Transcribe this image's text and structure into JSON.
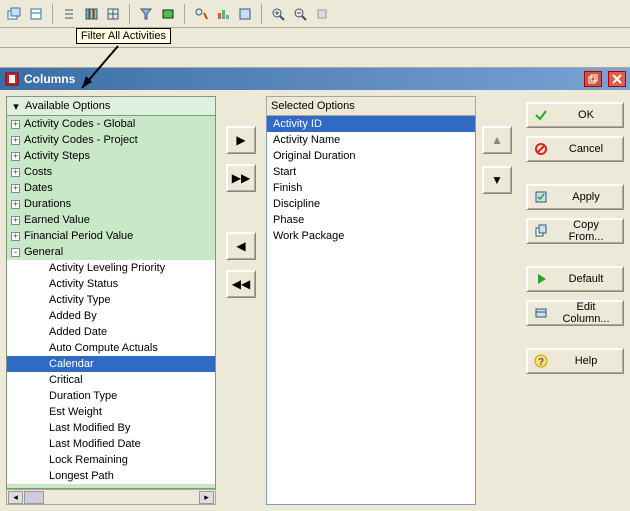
{
  "tooltip": "Filter All Activities",
  "dialog_title": "Columns",
  "available_header": "Available Options",
  "selected_header": "Selected Options",
  "tree_top": [
    "Activity Codes - Global",
    "Activity Codes - Project",
    "Activity Steps",
    "Costs",
    "Dates",
    "Durations",
    "Earned Value",
    "Financial Period Value"
  ],
  "tree_general_label": "General",
  "general_items": [
    "Activity Leveling Priority",
    "Activity Status",
    "Activity Type",
    "Added By",
    "Added Date",
    "Auto Compute Actuals",
    "Calendar",
    "Critical",
    "Duration Type",
    "Est Weight",
    "Last Modified By",
    "Last Modified Date",
    "Lock Remaining",
    "Longest Path"
  ],
  "general_selected_index": 6,
  "selected_items": [
    "Activity ID",
    "Activity Name",
    "Original Duration",
    "Start",
    "Finish",
    "Discipline",
    "Phase",
    "Work Package"
  ],
  "selected_active_index": 0,
  "buttons": {
    "ok": "OK",
    "cancel": "Cancel",
    "apply": "Apply",
    "copy_from": "Copy From...",
    "default": "Default",
    "edit_column": "Edit Column...",
    "help": "Help"
  }
}
